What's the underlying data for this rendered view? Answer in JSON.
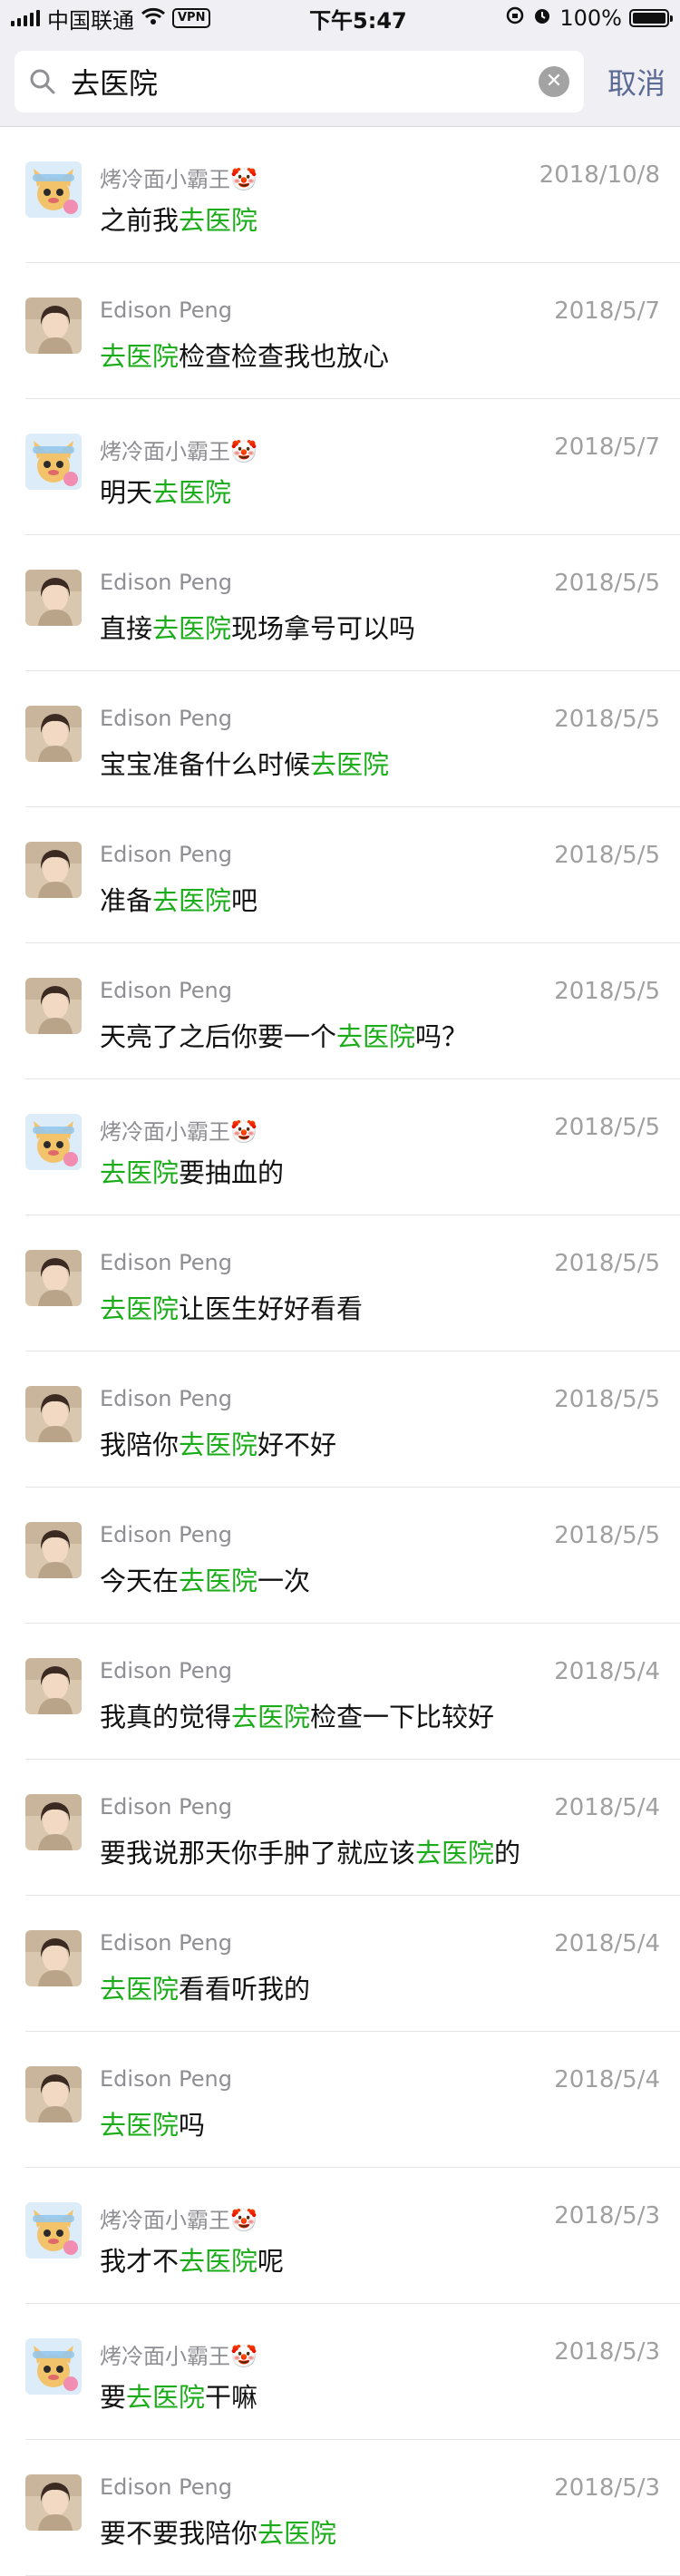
{
  "status_bar": {
    "carrier": "中国联通",
    "vpn": "VPN",
    "time": "下午5:47",
    "battery": "100%",
    "battery_level": 1.0
  },
  "search": {
    "query": "去医院",
    "cancel_label": "取消"
  },
  "colors": {
    "highlight": "#1aad19",
    "cancel": "#5b6b95"
  },
  "results": [
    {
      "sender": "烤冷面小霸王🤡",
      "avatar": "cartoon-avatar",
      "date": "2018/10/8",
      "pre": "之前我",
      "kw": "去医院",
      "post": ""
    },
    {
      "sender": "Edison Peng",
      "avatar": "photo-avatar",
      "date": "2018/5/7",
      "pre": "",
      "kw": "去医院",
      "post": "检查检查我也放心"
    },
    {
      "sender": "烤冷面小霸王🤡",
      "avatar": "cartoon-avatar",
      "date": "2018/5/7",
      "pre": "明天",
      "kw": "去医院",
      "post": ""
    },
    {
      "sender": "Edison Peng",
      "avatar": "photo-avatar",
      "date": "2018/5/5",
      "pre": "直接",
      "kw": "去医院",
      "post": "现场拿号可以吗"
    },
    {
      "sender": "Edison Peng",
      "avatar": "photo-avatar",
      "date": "2018/5/5",
      "pre": "宝宝准备什么时候",
      "kw": "去医院",
      "post": ""
    },
    {
      "sender": "Edison Peng",
      "avatar": "photo-avatar",
      "date": "2018/5/5",
      "pre": "准备",
      "kw": "去医院",
      "post": "吧"
    },
    {
      "sender": "Edison Peng",
      "avatar": "photo-avatar",
      "date": "2018/5/5",
      "pre": "天亮了之后你要一个",
      "kw": "去医院",
      "post": "吗？"
    },
    {
      "sender": "烤冷面小霸王🤡",
      "avatar": "cartoon-avatar",
      "date": "2018/5/5",
      "pre": "",
      "kw": "去医院",
      "post": "要抽血的"
    },
    {
      "sender": "Edison Peng",
      "avatar": "photo-avatar",
      "date": "2018/5/5",
      "pre": "",
      "kw": "去医院",
      "post": "让医生好好看看"
    },
    {
      "sender": "Edison Peng",
      "avatar": "photo-avatar",
      "date": "2018/5/5",
      "pre": "我陪你",
      "kw": "去医院",
      "post": "好不好"
    },
    {
      "sender": "Edison Peng",
      "avatar": "photo-avatar",
      "date": "2018/5/5",
      "pre": "今天在",
      "kw": "去医院",
      "post": "一次"
    },
    {
      "sender": "Edison Peng",
      "avatar": "photo-avatar",
      "date": "2018/5/4",
      "pre": "我真的觉得",
      "kw": "去医院",
      "post": "检查一下比较好"
    },
    {
      "sender": "Edison Peng",
      "avatar": "photo-avatar",
      "date": "2018/5/4",
      "pre": "要我说那天你手肿了就应该",
      "kw": "去医院",
      "post": "的"
    },
    {
      "sender": "Edison Peng",
      "avatar": "photo-avatar",
      "date": "2018/5/4",
      "pre": "",
      "kw": "去医院",
      "post": "看看听我的"
    },
    {
      "sender": "Edison Peng",
      "avatar": "photo-avatar",
      "date": "2018/5/4",
      "pre": "",
      "kw": "去医院",
      "post": "吗"
    },
    {
      "sender": "烤冷面小霸王🤡",
      "avatar": "cartoon-avatar",
      "date": "2018/5/3",
      "pre": "我才不",
      "kw": "去医院",
      "post": "呢"
    },
    {
      "sender": "烤冷面小霸王🤡",
      "avatar": "cartoon-avatar",
      "date": "2018/5/3",
      "pre": "要",
      "kw": "去医院",
      "post": "干嘛"
    },
    {
      "sender": "Edison Peng",
      "avatar": "photo-avatar",
      "date": "2018/5/3",
      "pre": "要不要我陪你",
      "kw": "去医院",
      "post": ""
    }
  ]
}
